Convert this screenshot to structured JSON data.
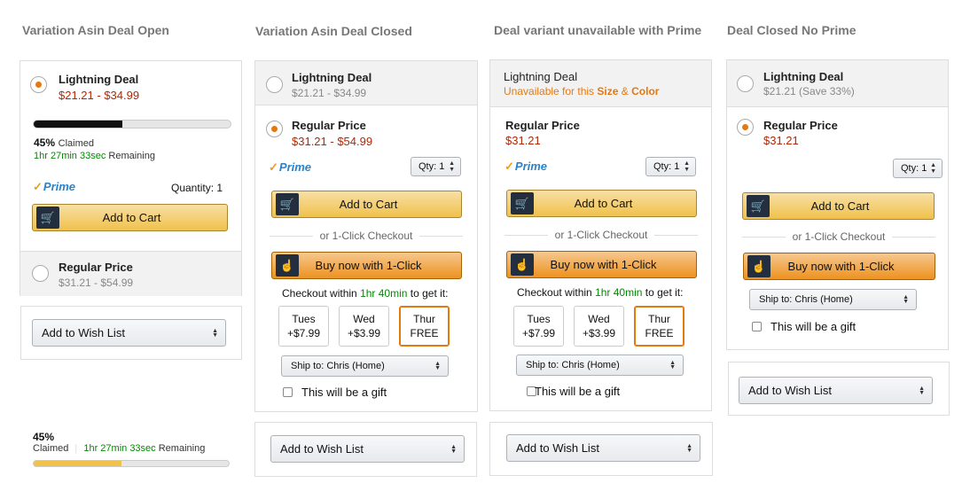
{
  "columns": [
    {
      "title": "Variation Asin Deal Open"
    },
    {
      "title": "Variation Asin Deal Closed"
    },
    {
      "title": "Deal variant unavailable with Prime"
    },
    {
      "title": "Deal Closed No Prime"
    }
  ],
  "col1": {
    "deal_label": "Lightning Deal",
    "deal_price": "$21.21 - $34.99",
    "claimed_percent": 45,
    "claimed_value": "45%",
    "claimed_text": "Claimed",
    "time_remaining": "1hr 27min 33sec",
    "remaining_text": "Remaining",
    "prime": "Prime",
    "quantity": "Quantity: 1",
    "add_to_cart": "Add to Cart",
    "regular_label": "Regular Price",
    "regular_price": "$31.21 - $54.99",
    "wishlist": "Add to Wish List"
  },
  "mini_progress": {
    "percent": "45%",
    "percent_value": 45,
    "claimed": "Claimed",
    "time": "1hr 27min 33sec",
    "remaining": "Remaining"
  },
  "col2": {
    "deal_label": "Lightning Deal",
    "deal_price": "$21.21 - $34.99",
    "regular_label": "Regular Price",
    "regular_price": "$31.21 - $54.99",
    "prime": "Prime",
    "qty": "Qty: 1",
    "add_to_cart": "Add to Cart",
    "one_click_divider": "or 1-Click Checkout",
    "buy_now": "Buy now with 1-Click",
    "checkout_prefix": "Checkout within",
    "checkout_time": "1hr 40min",
    "checkout_suffix": "to get it:",
    "days": [
      {
        "day": "Tues",
        "price": "+$7.99"
      },
      {
        "day": "Wed",
        "price": "+$3.99"
      },
      {
        "day": "Thur",
        "price": "FREE"
      }
    ],
    "ship_to": "Ship to: Chris (Home)",
    "gift": "This will be a gift",
    "wishlist": "Add to Wish List"
  },
  "col3": {
    "deal_label": "Lightning Deal",
    "unavailable_prefix": "Unavailable for this",
    "size": "Size",
    "amp": "&",
    "color": "Color",
    "regular_label": "Regular Price",
    "regular_price": "$31.21",
    "prime": "Prime",
    "qty": "Qty: 1",
    "add_to_cart": "Add to Cart",
    "one_click_divider": "or 1-Click Checkout",
    "buy_now": "Buy now with 1-Click",
    "checkout_prefix": "Checkout within",
    "checkout_time": "1hr 40min",
    "checkout_suffix": "to get it:",
    "days": [
      {
        "day": "Tues",
        "price": "+$7.99"
      },
      {
        "day": "Wed",
        "price": "+$3.99"
      },
      {
        "day": "Thur",
        "price": "FREE"
      }
    ],
    "ship_to": "Ship to: Chris (Home)",
    "gift": "This will be a gift",
    "wishlist": "Add to Wish List"
  },
  "col4": {
    "deal_label": "Lightning Deal",
    "deal_price": "$21.21 (Save 33%)",
    "regular_label": "Regular Price",
    "regular_price": "$31.21",
    "qty": "Qty: 1",
    "add_to_cart": "Add to Cart",
    "one_click_divider": "or 1-Click Checkout",
    "buy_now": "Buy now with 1-Click",
    "ship_to": "Ship to: Chris (Home)",
    "gift": "This will be a gift",
    "wishlist": "Add to Wish List"
  },
  "colors": {
    "accent_orange": "#e47911",
    "price_red": "#b12704",
    "green": "#008a00",
    "prime_blue": "#2d82c9",
    "deal_bar_fill": "#111111",
    "mini_bar_fill": "#f0c14b"
  },
  "icons": {
    "cart": "cart-icon",
    "one_click": "hand-pointer-icon",
    "prime_check": "prime-check-icon",
    "select_arrows": "updown-arrows-icon"
  }
}
